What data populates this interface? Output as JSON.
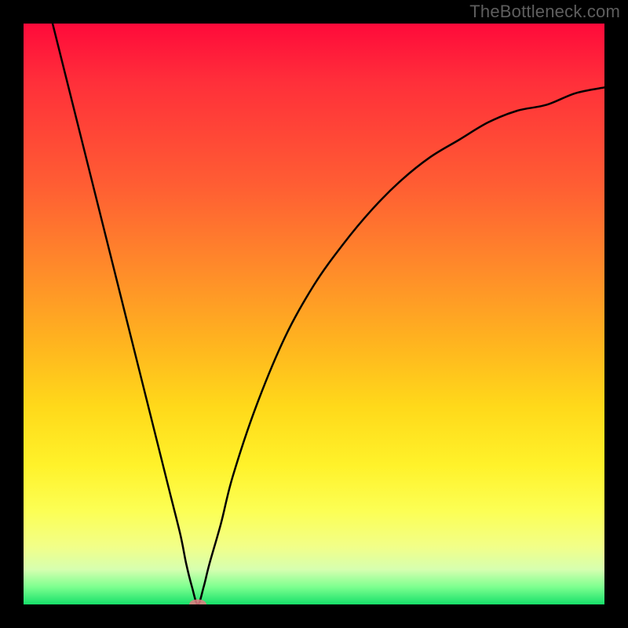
{
  "watermark": "TheBottleneck.com",
  "colors": {
    "frame": "#000000",
    "curve": "#000000",
    "marker": "#e47a82",
    "watermark_text": "#5e5e5e",
    "gradient_stops": [
      "#ff0a3a",
      "#ff5e33",
      "#ffb41f",
      "#fff22a",
      "#f2ff88",
      "#17e06a"
    ]
  },
  "chart_data": {
    "type": "line",
    "title": "",
    "xlabel": "",
    "ylabel": "",
    "xlim": [
      0,
      100
    ],
    "ylim": [
      0,
      100
    ],
    "grid": false,
    "legend": false,
    "note": "Unlabeled axes; values are estimated from pixel geometry. y≈100 at top edge of plot area, y≈0 at bottom.",
    "series": [
      {
        "name": "curve",
        "x": [
          5,
          10,
          15,
          20,
          25,
          27,
          28,
          29,
          30,
          31,
          32,
          34,
          36,
          40,
          45,
          50,
          55,
          60,
          65,
          70,
          75,
          80,
          85,
          90,
          95,
          100
        ],
        "y": [
          100,
          80,
          60,
          40,
          20,
          12,
          7,
          3,
          0,
          3,
          7,
          14,
          22,
          34,
          46,
          55,
          62,
          68,
          73,
          77,
          80,
          83,
          85,
          86,
          88,
          89
        ]
      }
    ],
    "marker": {
      "x": 30,
      "y": 0,
      "label": ""
    }
  }
}
